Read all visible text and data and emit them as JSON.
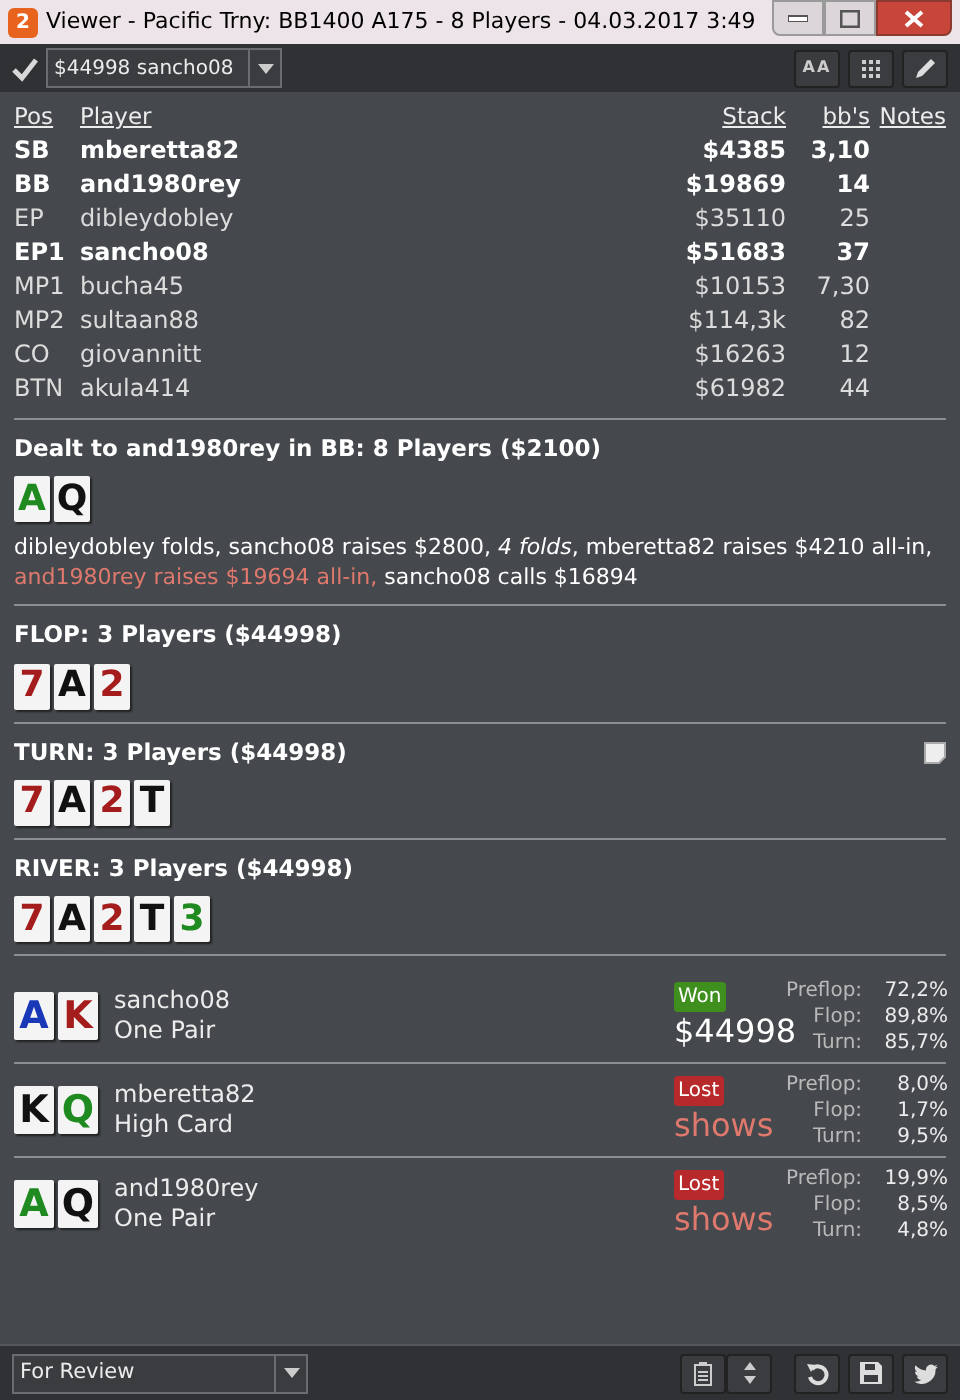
{
  "window": {
    "app_badge": "2",
    "title": "Viewer - Pacific Trny: BB1400 A175 - 8 Players - 04.03.2017 3:49"
  },
  "toolbar": {
    "filter_checked": true,
    "hand_select": "$44998 sancho08",
    "font_button": "AA"
  },
  "table": {
    "columns": [
      "Pos",
      "Player",
      "Stack",
      "bb's",
      "Notes"
    ],
    "rows": [
      {
        "pos": "SB",
        "player": "mberetta82",
        "stack": "$4385",
        "bbs": "3,10",
        "in_hand": true
      },
      {
        "pos": "BB",
        "player": "and1980rey",
        "stack": "$19869",
        "bbs": "14",
        "in_hand": true
      },
      {
        "pos": "EP",
        "player": "dibleydobley",
        "stack": "$35110",
        "bbs": "25",
        "in_hand": false
      },
      {
        "pos": "EP1",
        "player": "sancho08",
        "stack": "$51683",
        "bbs": "37",
        "in_hand": true
      },
      {
        "pos": "MP1",
        "player": "bucha45",
        "stack": "$10153",
        "bbs": "7,30",
        "in_hand": false
      },
      {
        "pos": "MP2",
        "player": "sultaan88",
        "stack": "$114,3k",
        "bbs": "82",
        "in_hand": false
      },
      {
        "pos": "CO",
        "player": "giovannitt",
        "stack": "$16263",
        "bbs": "12",
        "in_hand": false
      },
      {
        "pos": "BTN",
        "player": "akula414",
        "stack": "$61982",
        "bbs": "44",
        "in_hand": false
      }
    ]
  },
  "streets": [
    {
      "title": "Dealt to and1980rey in BB: 8 Players ($2100)",
      "note": false,
      "cards": [
        {
          "rank": "A",
          "color": "#1f8a1f"
        },
        {
          "rank": "Q",
          "color": "#111111"
        }
      ],
      "actions": [
        {
          "kind": "plain",
          "text": "dibleydobley folds, sancho08 raises $2800, "
        },
        {
          "kind": "folds",
          "text": "4 folds"
        },
        {
          "kind": "plain",
          "text": ", mberetta82 raises $4210 all-in, "
        },
        {
          "kind": "hero",
          "text": "and1980rey raises $19694 all-in,"
        },
        {
          "kind": "plain",
          "text": " sancho08 calls $16894"
        }
      ]
    },
    {
      "title": "FLOP: 3 Players ($44998)",
      "note": false,
      "cards": [
        {
          "rank": "7",
          "color": "#a51c1c"
        },
        {
          "rank": "A",
          "color": "#111111"
        },
        {
          "rank": "2",
          "color": "#a51c1c"
        }
      ]
    },
    {
      "title": "TURN: 3 Players ($44998)",
      "note": true,
      "cards": [
        {
          "rank": "7",
          "color": "#a51c1c"
        },
        {
          "rank": "A",
          "color": "#111111"
        },
        {
          "rank": "2",
          "color": "#a51c1c"
        },
        {
          "rank": "T",
          "color": "#111111"
        }
      ]
    },
    {
      "title": "RIVER: 3 Players ($44998)",
      "note": false,
      "cards": [
        {
          "rank": "7",
          "color": "#a51c1c"
        },
        {
          "rank": "A",
          "color": "#111111"
        },
        {
          "rank": "2",
          "color": "#a51c1c"
        },
        {
          "rank": "T",
          "color": "#111111"
        },
        {
          "rank": "3",
          "color": "#1f8a1f"
        }
      ]
    }
  ],
  "results": [
    {
      "cards": [
        {
          "rank": "A",
          "color": "#1838b8"
        },
        {
          "rank": "K",
          "color": "#a51c1c"
        }
      ],
      "player": "sancho08",
      "hand": "One Pair",
      "won": true,
      "badge": "Won",
      "amount": "$44998",
      "equity": [
        {
          "label": "Preflop:",
          "value": "72,2%"
        },
        {
          "label": "Flop:",
          "value": "89,8%"
        },
        {
          "label": "Turn:",
          "value": "85,7%"
        }
      ]
    },
    {
      "cards": [
        {
          "rank": "K",
          "color": "#111111"
        },
        {
          "rank": "Q",
          "color": "#1f8a1f"
        }
      ],
      "player": "mberetta82",
      "hand": "High Card",
      "won": false,
      "badge": "Lost",
      "amount": "shows",
      "equity": [
        {
          "label": "Preflop:",
          "value": "8,0%"
        },
        {
          "label": "Flop:",
          "value": "1,7%"
        },
        {
          "label": "Turn:",
          "value": "9,5%"
        }
      ]
    },
    {
      "cards": [
        {
          "rank": "A",
          "color": "#1f8a1f"
        },
        {
          "rank": "Q",
          "color": "#111111"
        }
      ],
      "player": "and1980rey",
      "hand": "One Pair",
      "won": false,
      "badge": "Lost",
      "amount": "shows",
      "equity": [
        {
          "label": "Preflop:",
          "value": "19,9%"
        },
        {
          "label": "Flop:",
          "value": "8,5%"
        },
        {
          "label": "Turn:",
          "value": "4,8%"
        }
      ]
    }
  ],
  "bottom": {
    "tag_select": "For Review"
  }
}
